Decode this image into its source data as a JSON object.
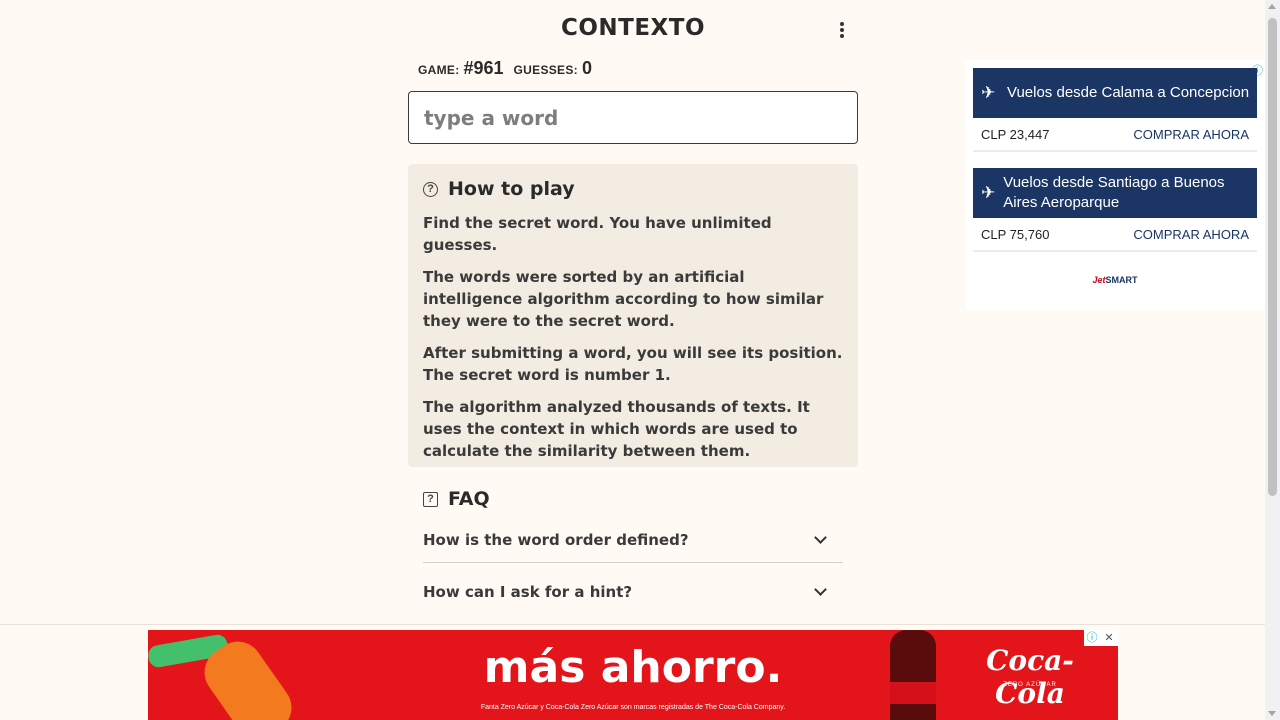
{
  "header": {
    "title": "CONTEXTO",
    "menu_icon": "kebab-menu-icon"
  },
  "game_info": {
    "game_label": "GAME:",
    "game_value": "#961",
    "guesses_label": "GUESSES:",
    "guesses_value": "0"
  },
  "input": {
    "placeholder": "type a word",
    "value": ""
  },
  "how_to_play": {
    "icon": "question-circle-icon",
    "title": "How to play",
    "paragraphs": [
      "Find the secret word. You have unlimited guesses.",
      "The words were sorted by an artificial intelligence algorithm according to how similar they were to the secret word.",
      "After submitting a word, you will see its position. The secret word is number 1.",
      "The algorithm analyzed thousands of texts. It uses the context in which words are used to calculate the similarity between them."
    ]
  },
  "faq": {
    "icon": "question-square-icon",
    "title": "FAQ",
    "items": [
      "How is the word order defined?",
      "How can I ask for a hint?"
    ]
  },
  "side_ad": {
    "adchoices": "ⓘ",
    "cards": [
      {
        "title": "Vuelos desde Calama a Concepcion",
        "price": "CLP 23,447",
        "cta": "COMPRAR AHORA"
      },
      {
        "title": "Vuelos desde Santiago a Buenos Aires Aeroparque",
        "price": "CLP 75,760",
        "cta": "COMPRAR AHORA"
      }
    ],
    "brand_prefix": "Jet",
    "brand_suffix": "SMART",
    "brand_color": "#1b3565"
  },
  "bottom_ad": {
    "headline": "más ahorro.",
    "fine_print": "Fanta Zero Azúcar y Coca-Cola Zero Azúcar son marcas registradas de The Coca-Cola Company.",
    "brand": "Coca-Cola",
    "brand_sub": "ZERO AZÚCAR",
    "info_label": "ⓘ",
    "close_label": "✕",
    "background_color": "#e4141b"
  }
}
